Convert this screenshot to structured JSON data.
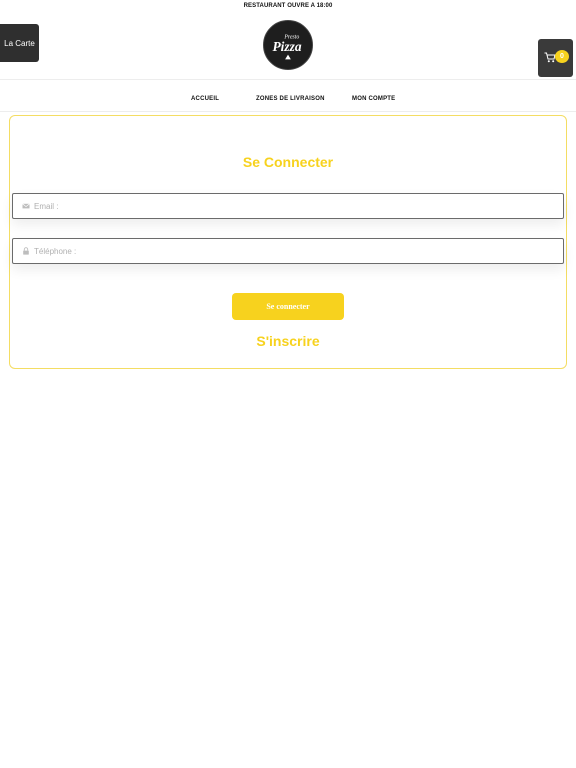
{
  "header": {
    "banner": "RESTAURANT OUVRE A 18:00",
    "menu_button": "La Carte",
    "logo": {
      "word1": "Presto",
      "word2": "Pizza",
      "icon": "pizza-logo"
    },
    "cart": {
      "icon": "cart-icon",
      "count": "0"
    }
  },
  "nav": {
    "items": [
      {
        "label": "ACCUEIL"
      },
      {
        "label": "ZONES DE LIVRAISON"
      },
      {
        "label": "MON COMPTE"
      }
    ]
  },
  "login": {
    "title": "Se Connecter",
    "email": {
      "value": "",
      "placeholder": "Email :",
      "icon": "envelope-icon"
    },
    "phone": {
      "value": "",
      "placeholder": "Téléphone :",
      "icon": "lock-icon"
    },
    "submit_label": "Se connecter",
    "register_label": "S'inscrire"
  },
  "colors": {
    "accent": "#f7d21e",
    "dark_button": "#2f2f2f",
    "card_border": "#f4dd63"
  }
}
